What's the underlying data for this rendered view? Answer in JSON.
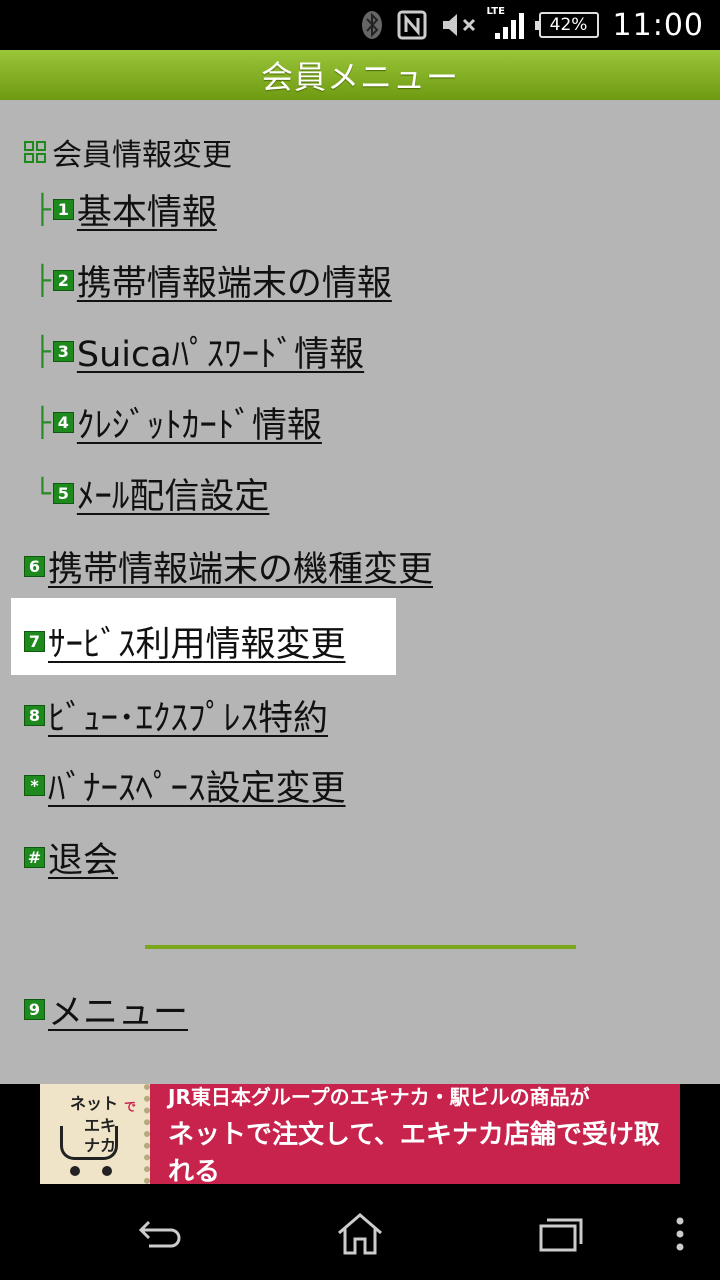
{
  "status_bar": {
    "battery": "42%",
    "network": "LTE",
    "time": "11:00",
    "icons": [
      "bluetooth-icon",
      "nfc-icon",
      "mute-icon",
      "signal-icon",
      "battery-icon"
    ]
  },
  "title": "会員メニュー",
  "menu": {
    "section_header": "会員情報変更",
    "sub_items": [
      {
        "num": "1",
        "label": "基本情報"
      },
      {
        "num": "2",
        "label": "携帯情報端末の情報"
      },
      {
        "num": "3",
        "label": "Suicaﾊﾟｽﾜｰﾄﾞ情報"
      },
      {
        "num": "4",
        "label": "ｸﾚｼﾞｯﾄｶｰﾄﾞ情報"
      },
      {
        "num": "5",
        "label": "ﾒｰﾙ配信設定"
      }
    ],
    "items": [
      {
        "num": "6",
        "label": "携帯情報端末の機種変更"
      },
      {
        "num": "7",
        "label": "ｻｰﾋﾞｽ利用情報変更"
      },
      {
        "num": "8",
        "label": "ﾋﾞｭｰ･ｴｸｽﾌﾟﾚｽ特約"
      },
      {
        "num": "*",
        "label": "ﾊﾞﾅｰｽﾍﾟｰｽ設定変更"
      },
      {
        "num": "#",
        "label": "退会"
      }
    ],
    "bottom": {
      "num": "9",
      "label": "メニュー"
    }
  },
  "banner": {
    "logo_line1": "ネット",
    "logo_line2": "で",
    "logo_line3": "エキ",
    "logo_line4": "ナカ",
    "line1": "JR東日本グループのエキナカ・駅ビルの商品が",
    "line2": "ネットで注文して、エキナカ店舗で受け取れる"
  },
  "colors": {
    "title_bar": "#7fab1f",
    "content_bg": "#b5b5b5",
    "number_badge": "#1e8a1e",
    "banner_bg": "#c7234d"
  }
}
